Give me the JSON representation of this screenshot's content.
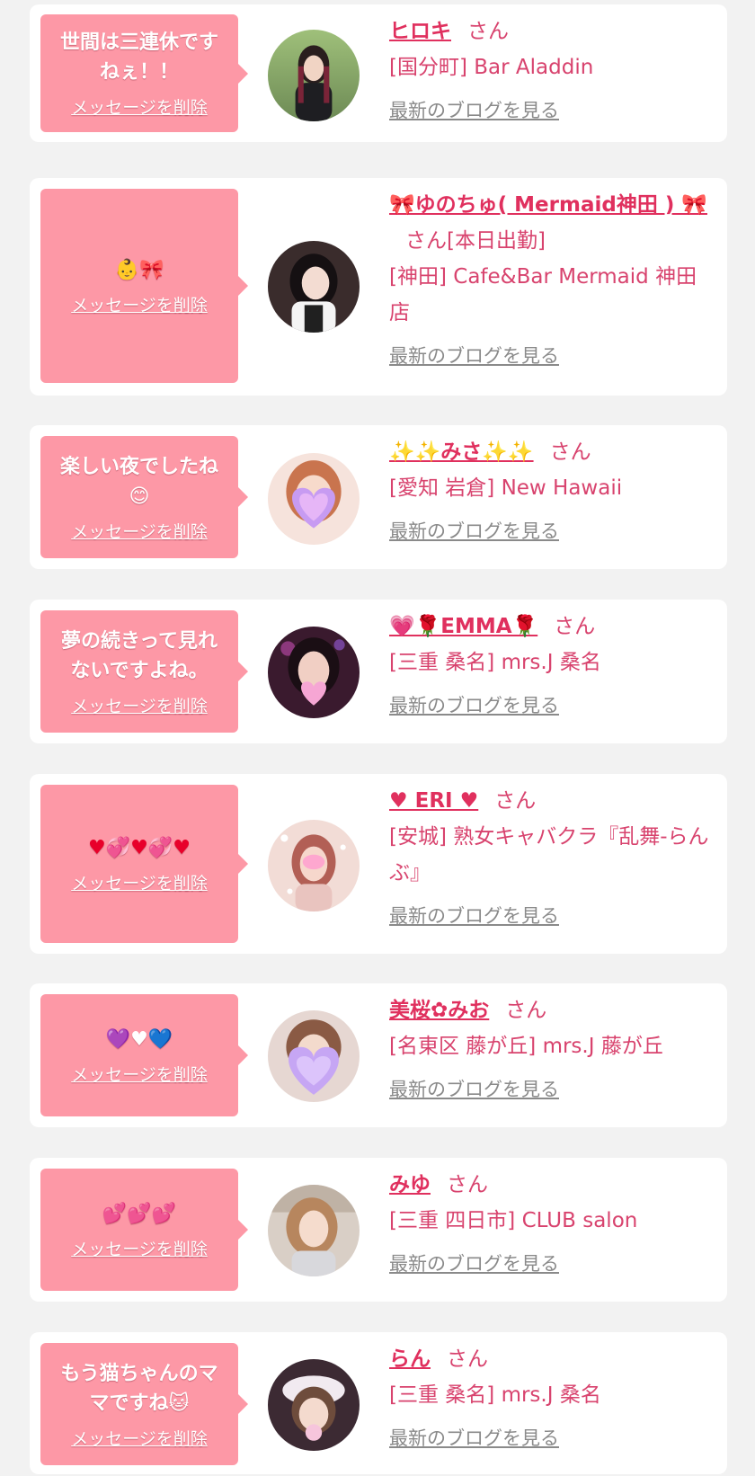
{
  "delete_label": "メッセージを削除",
  "blog_label": "最新のブログを見る",
  "san_label": "さん",
  "items": [
    {
      "message": "世間は三連休ですねぇ！！",
      "name": "ヒロキ",
      "name_suffix": "",
      "shop": "[国分町] Bar Aladdin"
    },
    {
      "message": "👶🎀",
      "name": "🎀ゆのちゅ( Mermaid神田 ) 🎀",
      "name_suffix": "[本日出勤]",
      "shop": "[神田] Cafe&Bar Mermaid 神田店"
    },
    {
      "message": "楽しい夜でしたね😊",
      "name": "✨✨みさ✨✨",
      "name_suffix": "",
      "shop": "[愛知 岩倉] New Hawaii"
    },
    {
      "message": "夢の続きって見れないですよね。",
      "name": "💗🌹EMMA🌹",
      "name_suffix": "",
      "shop": "[三重 桑名] mrs.J 桑名"
    },
    {
      "message": "♥💞♥💞♥",
      "name": "♥ ERI ♥",
      "name_suffix": "",
      "shop": "[安城] 熟女キャバクラ『乱舞-らんぶ』"
    },
    {
      "message": "💜♥💙",
      "name": "美桜✿みお",
      "name_suffix": "",
      "shop": "[名東区 藤が丘] mrs.J 藤が丘"
    },
    {
      "message": "💕💕💕",
      "name": "みゆ",
      "name_suffix": "",
      "shop": "[三重 四日市] CLUB salon"
    },
    {
      "message": "もう猫ちゃんのママですね🐱",
      "name": "らん",
      "name_suffix": "",
      "shop": "[三重 桑名] mrs.J 桑名"
    }
  ],
  "colors": {
    "page_bg": "#f2f2f2",
    "bubble": "#fd98a6",
    "name": "#e0305e",
    "text": "#d8436e",
    "link_gray": "#8a8a8a"
  }
}
